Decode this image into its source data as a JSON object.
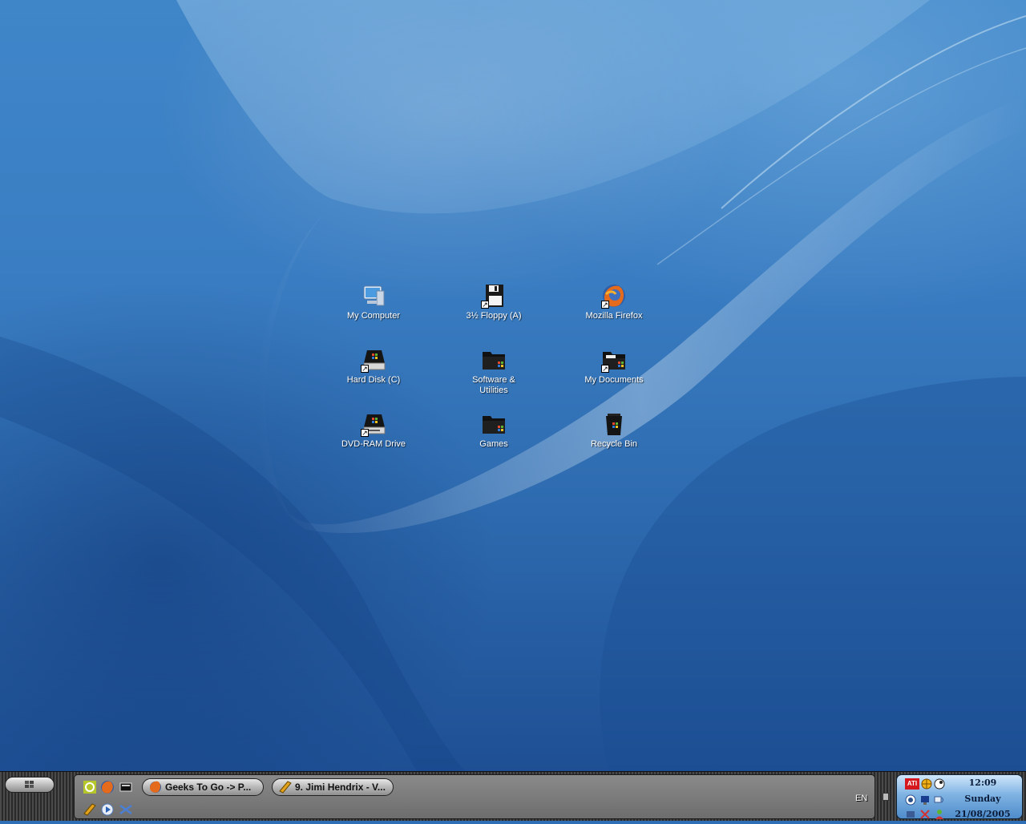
{
  "desktop": {
    "icons": [
      {
        "label": "My Computer",
        "icon": "computer-icon",
        "shortcut": false
      },
      {
        "label": "3½ Floppy (A)",
        "icon": "floppy-icon",
        "shortcut": true
      },
      {
        "label": "Mozilla Firefox",
        "icon": "firefox-icon",
        "shortcut": true
      },
      {
        "label": "Hard Disk (C)",
        "icon": "hard-disk-icon",
        "shortcut": true
      },
      {
        "label": "Software & Utilities",
        "icon": "folder-icon",
        "shortcut": false
      },
      {
        "label": "My Documents",
        "icon": "documents-folder-icon",
        "shortcut": true
      },
      {
        "label": "DVD-RAM Drive",
        "icon": "dvd-drive-icon",
        "shortcut": true
      },
      {
        "label": "Games",
        "icon": "folder-icon",
        "shortcut": false
      },
      {
        "label": "Recycle Bin",
        "icon": "recycle-bin-icon",
        "shortcut": false
      }
    ]
  },
  "taskbar": {
    "start_icon": "windows-logo-icon",
    "quick_launch": [
      {
        "icon": "refresh-app-icon"
      },
      {
        "icon": "firefox-icon"
      },
      {
        "icon": "show-desktop-icon"
      },
      {
        "icon": "winamp-icon"
      },
      {
        "icon": "media-player-icon"
      },
      {
        "icon": "network-icon"
      }
    ],
    "tasks": [
      {
        "label": "Geeks To Go -> P...",
        "icon": "firefox-icon"
      },
      {
        "label": "9. Jimi Hendrix - V...",
        "icon": "winamp-icon"
      }
    ],
    "language": "EN"
  },
  "tray": {
    "time": "12:09",
    "day": "Sunday",
    "date": "21/08/2005",
    "icons": [
      "ati-icon",
      "globe-icon",
      "steam-icon",
      "antivirus-icon",
      "network-adapter-icon",
      "wireless-icon",
      "messenger-icon",
      "connection-icon",
      "volume-icon",
      "user-icon"
    ],
    "ati_text": "ATI"
  },
  "colors": {
    "desktop_blue": "#3a7dc2",
    "taskbar_dark": "#2a2a2a",
    "tray_blue": "#7fb3e3"
  }
}
